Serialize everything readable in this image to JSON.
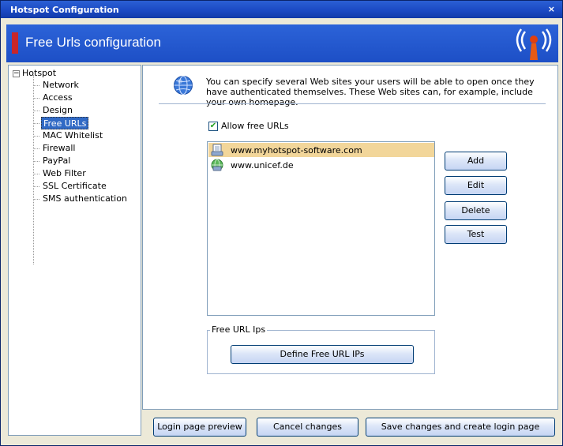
{
  "window": {
    "title": "Hotspot Configuration",
    "close_label": "×"
  },
  "header": {
    "title": "Free Urls configuration",
    "icon": "antenna-icon"
  },
  "tree": {
    "root": "Hotspot",
    "expander": "−",
    "items": [
      {
        "label": "Network",
        "selected": false
      },
      {
        "label": "Access",
        "selected": false
      },
      {
        "label": "Design",
        "selected": false
      },
      {
        "label": "Free URLs",
        "selected": true
      },
      {
        "label": "MAC Whitelist",
        "selected": false
      },
      {
        "label": "Firewall",
        "selected": false
      },
      {
        "label": "PayPal",
        "selected": false
      },
      {
        "label": "Web Filter",
        "selected": false
      },
      {
        "label": "SSL Certificate",
        "selected": false
      },
      {
        "label": "SMS authentication",
        "selected": false
      }
    ]
  },
  "info": {
    "text": "You can specify several Web sites your users will be able to open once they have authenticated themselves. These Web sites can, for example, include your own homepage."
  },
  "allow": {
    "label": "Allow free URLs",
    "checked": true,
    "check_glyph": "✔"
  },
  "urls": [
    {
      "url": "www.myhotspot-software.com",
      "selected": true,
      "icon": "page-icon"
    },
    {
      "url": "www.unicef.de",
      "selected": false,
      "icon": "globe-icon"
    }
  ],
  "buttons": {
    "add": "Add",
    "edit": "Edit",
    "delete": "Delete",
    "test": "Test",
    "define_ips": "Define Free URL IPs",
    "login_preview": "Login page preview",
    "cancel": "Cancel changes",
    "save": "Save changes and create login page"
  },
  "group": {
    "legend": "Free URL Ips"
  },
  "colors": {
    "title_bar": "#1a48c2",
    "header": "#2c63d8",
    "accent_red": "#c8262a",
    "selection": "#316ac5",
    "row_highlight": "#f2d69a"
  }
}
